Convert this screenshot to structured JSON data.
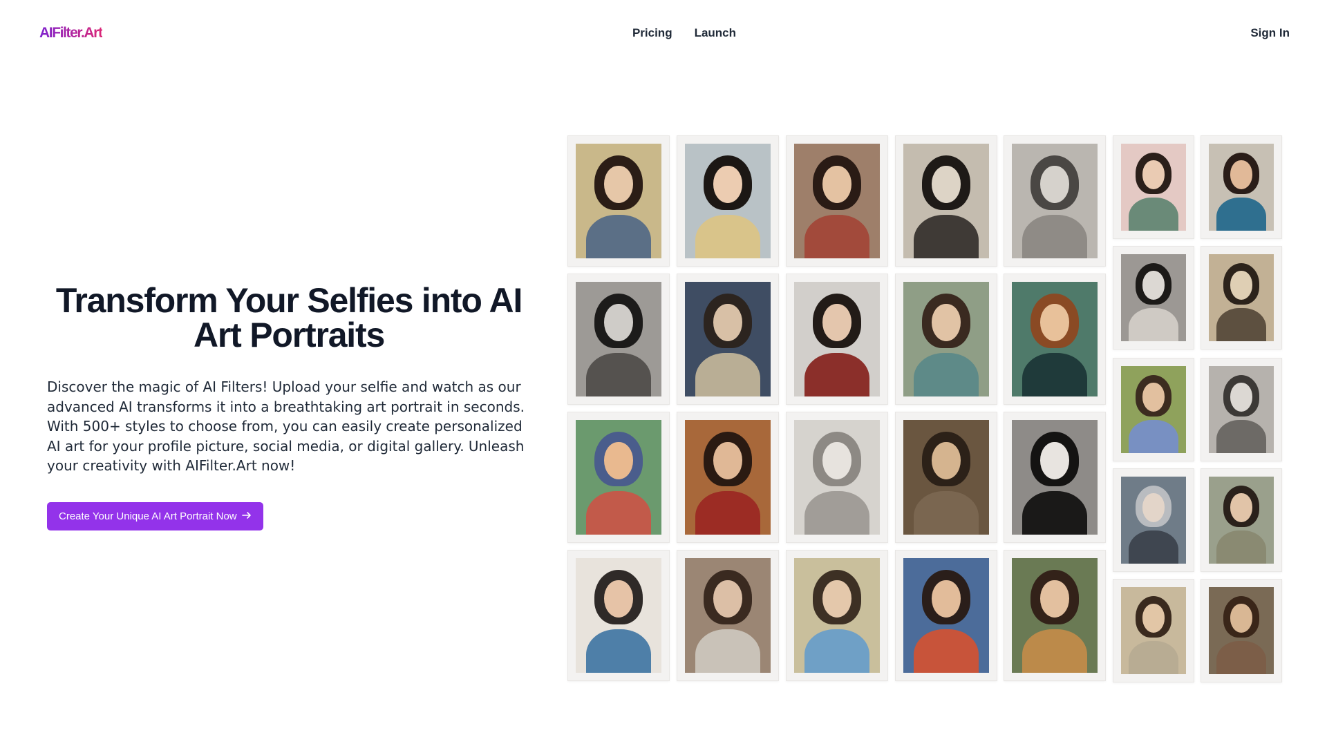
{
  "header": {
    "logo": "AIFilter.Art",
    "nav": [
      "Pricing",
      "Launch"
    ],
    "sign_in": "Sign In"
  },
  "hero": {
    "title": "Transform Your Selfies into AI Art Portraits",
    "description": "Discover the magic of AI Filters! Upload your selfie and watch as our advanced AI transforms it into a breathtaking art portrait in seconds. With 500+ styles to choose from, you can easily create personalized AI art for your profile picture, social media, or digital gallery. Unleash your creativity with AIFilter.Art now!",
    "cta_label": "Create Your Unique AI Art Portrait Now",
    "cta_icon": "arrow-right-icon"
  },
  "colors": {
    "accent": "#9333ea",
    "logo_gradient": [
      "#7e22ce",
      "#db2777"
    ]
  },
  "gallery": {
    "portraits": [
      {
        "style": "vintage-poster",
        "bg": "#c9b88a",
        "hair": "#2b1d16",
        "skin": "#e6c7a8",
        "cloth": "#5b6f86"
      },
      {
        "style": "hat-portrait",
        "bg": "#b9c2c6",
        "hair": "#1c1714",
        "skin": "#ecccb1",
        "cloth": "#d9c48a"
      },
      {
        "style": "cubist",
        "bg": "#9e7f6a",
        "hair": "#2a1b15",
        "skin": "#e4c2a2",
        "cloth": "#a24a3b"
      },
      {
        "style": "ink-sketch",
        "bg": "#c4bcaf",
        "hair": "#1e1a17",
        "skin": "#ddd4c6",
        "cloth": "#3f3a36"
      },
      {
        "style": "charcoal",
        "bg": "#bab6b0",
        "hair": "#4a4744",
        "skin": "#d6d2cc",
        "cloth": "#8f8b86"
      },
      {
        "style": "bw-photo",
        "bg": "#9d9a96",
        "hair": "#1c1b1a",
        "skin": "#cfccc8",
        "cloth": "#55524f"
      },
      {
        "style": "muted-oil",
        "bg": "#3f4d63",
        "hair": "#2c241f",
        "skin": "#d8c0a6",
        "cloth": "#b9ae95"
      },
      {
        "style": "curly-gouache",
        "bg": "#d2cfcb",
        "hair": "#221b17",
        "skin": "#e4c6ad",
        "cloth": "#8b2f2a"
      },
      {
        "style": "teal-oil",
        "bg": "#8f9e86",
        "hair": "#3a2a20",
        "skin": "#e1c3a5",
        "cloth": "#5e8a88"
      },
      {
        "style": "mosaic",
        "bg": "#4f7a6a",
        "hair": "#8a4a24",
        "skin": "#e8c19a",
        "cloth": "#1f3a3a"
      },
      {
        "style": "psychedelic",
        "bg": "#6b9a6e",
        "hair": "#4a5d8c",
        "skin": "#e9b98f",
        "cloth": "#c25a4a"
      },
      {
        "style": "klimt",
        "bg": "#a8683a",
        "hair": "#2a1a12",
        "skin": "#e0b896",
        "cloth": "#9c2c24"
      },
      {
        "style": "pencil",
        "bg": "#d6d3ce",
        "hair": "#8d8984",
        "skin": "#e7e3de",
        "cloth": "#a19d98"
      },
      {
        "style": "sepia-oil",
        "bg": "#6a5640",
        "hair": "#2c2118",
        "skin": "#d5b48f",
        "cloth": "#7a6650"
      },
      {
        "style": "bw-glam",
        "bg": "#8e8b88",
        "hair": "#141312",
        "skin": "#e8e4e0",
        "cloth": "#1a1918"
      },
      {
        "style": "watercolor-splash",
        "bg": "#e8e3dc",
        "hair": "#2f2a28",
        "skin": "#e6c3a7",
        "cloth": "#4e7fa8"
      },
      {
        "style": "soft-oil",
        "bg": "#9b8674",
        "hair": "#3a2a20",
        "skin": "#dcbfa6",
        "cloth": "#c9c2b8"
      },
      {
        "style": "pastel-oil",
        "bg": "#c9bf9c",
        "hair": "#3d3024",
        "skin": "#e4c8ab",
        "cloth": "#6fa0c6"
      },
      {
        "style": "geometric",
        "bg": "#4c6c9a",
        "hair": "#2a1e1a",
        "skin": "#e2bc9a",
        "cloth": "#c8543a"
      },
      {
        "style": "retro-print",
        "bg": "#6a7a54",
        "hair": "#332219",
        "skin": "#e3c09f",
        "cloth": "#bc8a4a"
      },
      {
        "style": "floral",
        "bg": "#e4c9c4",
        "hair": "#2b1f1a",
        "skin": "#eacbb3",
        "cloth": "#6a8a78"
      },
      {
        "style": "color-block",
        "bg": "#c7c0b4",
        "hair": "#2a1d18",
        "skin": "#e1b998",
        "cloth": "#2f6f8f"
      },
      {
        "style": "ruffle-bw",
        "bg": "#9c9894",
        "hair": "#1c1a18",
        "skin": "#dcd8d3",
        "cloth": "#cfcac4"
      },
      {
        "style": "sepia-sketch",
        "bg": "#c2b195",
        "hair": "#2c231b",
        "skin": "#dfcfb4",
        "cloth": "#5d5040"
      },
      {
        "style": "impressionist",
        "bg": "#8fa25c",
        "hair": "#3c2c20",
        "skin": "#e2c09f",
        "cloth": "#7890c2"
      },
      {
        "style": "engraving",
        "bg": "#b6b2ad",
        "hair": "#3c3936",
        "skin": "#dcd8d3",
        "cloth": "#6d6a66"
      },
      {
        "style": "silver-curls",
        "bg": "#6f7c88",
        "hair": "#b9bcc0",
        "skin": "#e3d5c9",
        "cloth": "#3f4650"
      },
      {
        "style": "classic-portrait",
        "bg": "#9aa08c",
        "hair": "#2a211b",
        "skin": "#e1c4a8",
        "cloth": "#8a8a72"
      },
      {
        "style": "antique",
        "bg": "#c8b99c",
        "hair": "#3a2a1e",
        "skin": "#e2c6a6",
        "cloth": "#b8ac93"
      },
      {
        "style": "renaissance",
        "bg": "#7a6a55",
        "hair": "#3a2619",
        "skin": "#d9b794",
        "cloth": "#7c5e48"
      }
    ]
  }
}
